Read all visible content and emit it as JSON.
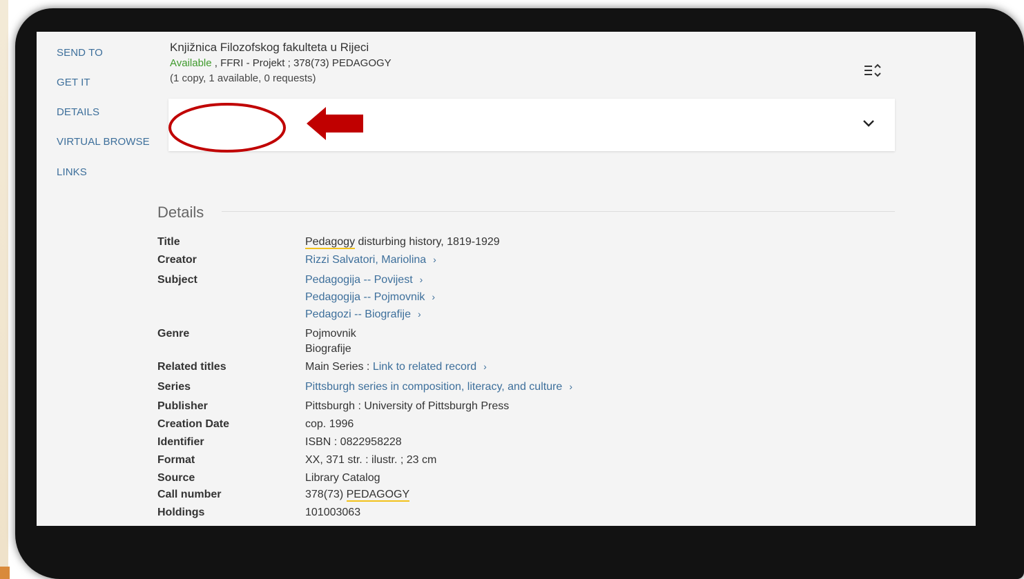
{
  "nav": {
    "items": [
      {
        "label": "SEND TO"
      },
      {
        "label": "GET IT"
      },
      {
        "label": "DETAILS"
      },
      {
        "label": "VIRTUAL BROWSE"
      },
      {
        "label": "LINKS"
      }
    ]
  },
  "holdings": {
    "library_name": "Knjižnica Filozofskog fakulteta u Rijeci",
    "status": "Available",
    "location_line": " , FFRI - Projekt ; 378(73) PEDAGOGY",
    "copies": "(1 copy, 1 available, 0 requests)",
    "sort_icon": "sort-icon",
    "expand_icon": "chevron-down-icon"
  },
  "annotation": {
    "ellipse_color": "#c00000",
    "arrow_color": "#c00000"
  },
  "details": {
    "heading": "Details",
    "title_label": "Title",
    "title_hl": "Pedagogy",
    "title_rest": " disturbing history, 1819-1929",
    "creator_label": "Creator",
    "creator_value": "Rizzi Salvatori, Mariolina",
    "subject_label": "Subject",
    "subjects": [
      "Pedagogija -- Povijest",
      "Pedagogija -- Pojmovnik",
      "Pedagozi -- Biografije"
    ],
    "genre_label": "Genre",
    "genres": [
      "Pojmovnik",
      "Biografije"
    ],
    "related_label": "Related titles",
    "related_prefix": "Main Series : ",
    "related_link": "Link to related record",
    "series_label": "Series",
    "series_value": "Pittsburgh series in composition, literacy, and culture",
    "publisher_label": "Publisher",
    "publisher_value": "Pittsburgh : University of Pittsburgh Press",
    "creation_label": "Creation Date",
    "creation_value": "cop. 1996",
    "identifier_label": "Identifier",
    "identifier_value": "ISBN : 0822958228",
    "format_label": "Format",
    "format_value": "XX, 371 str. : ilustr. ; 23 cm",
    "source_label": "Source",
    "source_value": "Library Catalog",
    "callnumber_label": "Call number",
    "callnumber_prefix": "378(73) ",
    "callnumber_hl": "PEDAGOGY",
    "holdings_label": "Holdings",
    "holdings_value": "101003063",
    "chevron_glyph": "›"
  },
  "colors": {
    "link": "#3d6f9b",
    "available": "#3f9a2c",
    "highlight": "#f2c21b"
  }
}
